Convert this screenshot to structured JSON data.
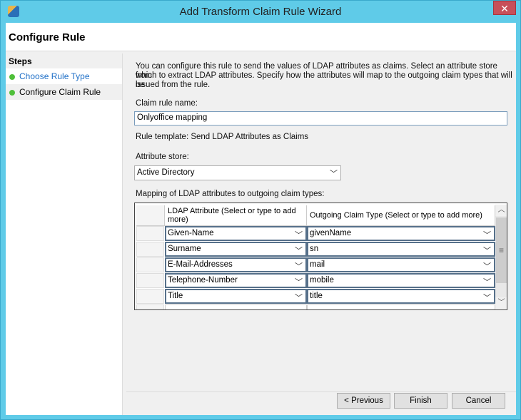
{
  "window": {
    "title": "Add Transform Claim Rule Wizard",
    "close": "✕"
  },
  "header": {
    "title": "Configure Rule"
  },
  "steps": {
    "heading": "Steps",
    "items": [
      {
        "label": "Choose Rule Type"
      },
      {
        "label": "Configure Claim Rule"
      }
    ]
  },
  "main": {
    "description_lines": [
      "You can configure this rule to send the values of LDAP attributes as claims. Select an attribute store from",
      "which to extract LDAP attributes. Specify how the attributes will map to the outgoing claim types that will be",
      "issued from the rule."
    ],
    "claim_rule_name_label": "Claim rule name:",
    "claim_rule_name_value": "Onlyoffice mapping",
    "rule_template": "Rule template: Send LDAP Attributes as Claims",
    "attribute_store_label": "Attribute store:",
    "attribute_store_value": "Active Directory",
    "mapping_label": "Mapping of LDAP attributes to outgoing claim types:",
    "columns": [
      "LDAP Attribute (Select or type to add more)",
      "Outgoing Claim Type (Select or type to add more)"
    ],
    "rows": [
      {
        "ldap": "Given-Name",
        "claim": "givenName"
      },
      {
        "ldap": "Surname",
        "claim": "sn"
      },
      {
        "ldap": "E-Mail-Addresses",
        "claim": "mail"
      },
      {
        "ldap": "Telephone-Number",
        "claim": "mobile"
      },
      {
        "ldap": "Title",
        "claim": "title"
      }
    ]
  },
  "buttons": {
    "previous": "< Previous",
    "finish": "Finish",
    "cancel": "Cancel"
  }
}
